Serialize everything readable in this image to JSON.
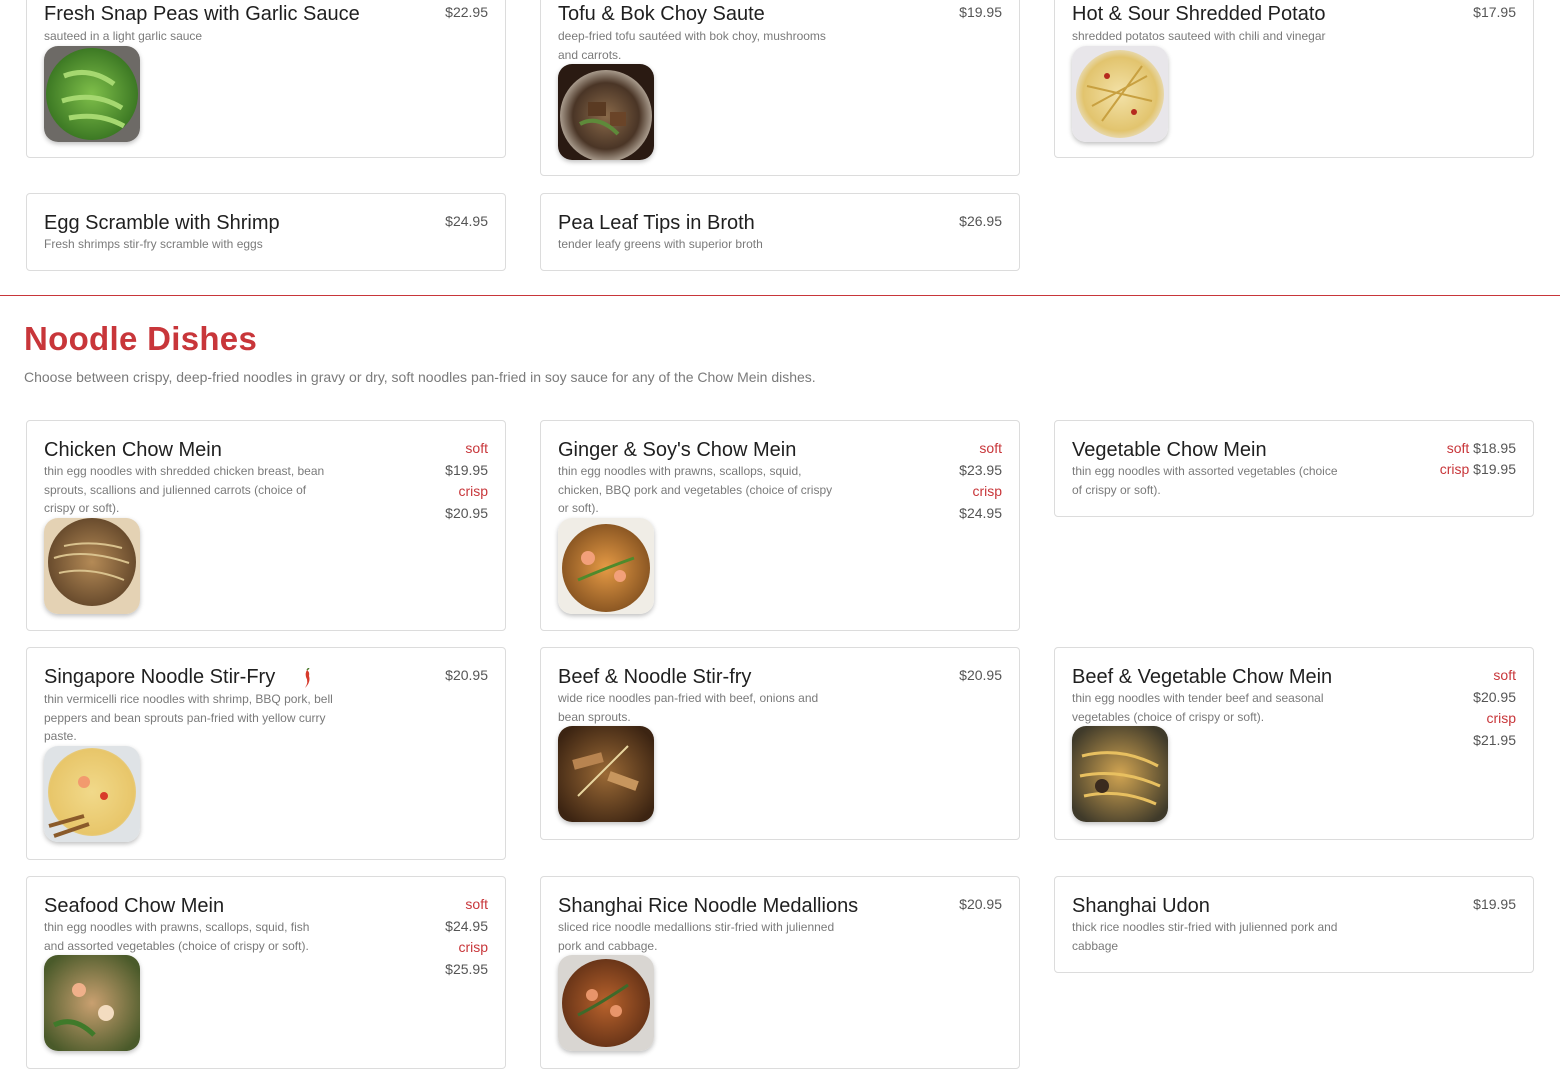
{
  "top_cards": [
    {
      "title": "Fresh Snap Peas with Garlic Sauce",
      "desc": "sauteed in a light garlic sauce",
      "price": "$22.95"
    },
    {
      "title": "Tofu & Bok Choy Saute",
      "desc": "deep-fried tofu sautéed with bok choy, mushrooms and carrots.",
      "price": "$19.95"
    },
    {
      "title": "Hot & Sour Shredded Potato",
      "desc": "shredded potatos sauteed with chili and vinegar",
      "price": "$17.95"
    },
    {
      "title": "Egg Scramble with Shrimp",
      "desc": "Fresh shrimps stir-fry scramble with eggs",
      "price": "$24.95"
    },
    {
      "title": "Pea Leaf Tips in Broth",
      "desc": "tender leafy greens with superior broth",
      "price": "$26.95"
    }
  ],
  "section": {
    "title": "Noodle Dishes",
    "subtitle": "Choose between crispy, deep-fried noodles in gravy or dry, soft noodles pan-fried in soy sauce for any of the Chow Mein dishes."
  },
  "noodles": [
    {
      "title": "Chicken Chow Mein",
      "desc": "thin egg noodles with shredded chicken breast, bean sprouts, scallions and julienned carrots (choice of crispy or soft).",
      "soft_label": "soft",
      "soft_price": "$19.95",
      "crisp_label": "crisp",
      "crisp_price": "$20.95"
    },
    {
      "title": "Ginger & Soy's Chow Mein",
      "desc": "thin egg noodles with prawns, scallops, squid, chicken, BBQ pork and vegetables (choice of crispy or soft).",
      "soft_label": "soft",
      "soft_price": "$23.95",
      "crisp_label": "crisp",
      "crisp_price": "$24.95"
    },
    {
      "title": "Vegetable Chow Mein",
      "desc": "thin egg noodles with assorted vegetables (choice of crispy or soft).",
      "soft_label": "soft",
      "soft_price": "$18.95",
      "crisp_label": "crisp",
      "crisp_price": "$19.95"
    },
    {
      "title": "Singapore Noodle Stir-Fry",
      "desc": "thin vermicelli rice noodles with shrimp, BBQ pork, bell peppers and bean sprouts pan-fried with yellow curry paste.",
      "price": "$20.95"
    },
    {
      "title": "Beef & Noodle Stir-fry",
      "desc": "wide rice noodles pan-fried with beef, onions and bean sprouts.",
      "price": "$20.95"
    },
    {
      "title": "Beef & Vegetable Chow Mein",
      "desc": "thin egg noodles with tender beef and seasonal vegetables (choice of crispy or soft).",
      "soft_label": "soft",
      "soft_price": "$20.95",
      "crisp_label": "crisp",
      "crisp_price": "$21.95"
    },
    {
      "title": "Seafood Chow Mein",
      "desc": "thin egg noodles with prawns, scallops, squid, fish and assorted vegetables (choice of crispy or soft).",
      "soft_label": "soft",
      "soft_price": "$24.95",
      "crisp_label": "crisp",
      "crisp_price": "$25.95"
    },
    {
      "title": "Shanghai Rice Noodle Medallions",
      "desc": "sliced rice noodle medallions stir-fried with julienned pork and cabbage.",
      "price": "$20.95"
    },
    {
      "title": "Shanghai Udon",
      "desc": "thick rice noodles stir-fried with julienned pork and cabbage",
      "price": "$19.95"
    }
  ],
  "icons": {
    "spicy": "chili-pepper-icon"
  },
  "colors": {
    "accent": "#c8363a",
    "text": "#1f1f1f",
    "muted": "#7a7a7a",
    "border": "#dcdcdc"
  }
}
